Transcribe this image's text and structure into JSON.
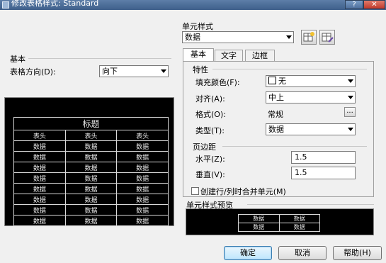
{
  "window": {
    "title": "修改表格样式: Standard",
    "help_glyph": "?",
    "close_glyph": "✕"
  },
  "left": {
    "basic_group_title": "基本",
    "direction_label": "表格方向(D):",
    "direction_value": "向下"
  },
  "preview": {
    "title": "标题",
    "header_cells": [
      "表头",
      "表头",
      "表头"
    ],
    "data_cell": "数据",
    "data_rows": 8
  },
  "cell_style": {
    "group_title": "单元样式",
    "value": "数据",
    "tabs": [
      "基本",
      "文字",
      "边框"
    ],
    "props_title": "特性",
    "fill_label": "填充颜色(F):",
    "fill_value": "无",
    "align_label": "对齐(A):",
    "align_value": "中上",
    "format_label": "格式(O):",
    "format_value": "常规",
    "format_button": "...",
    "type_label": "类型(T):",
    "type_value": "数据",
    "margins_title": "页边距",
    "horizontal_label": "水平(Z):",
    "horizontal_value": "1.5",
    "vertical_label": "垂直(V):",
    "vertical_value": "1.5",
    "merge_label": "创建行/列时合并单元(M)",
    "merge_checked": false,
    "style_preview_title": "单元样式预览",
    "style_preview_cells": [
      "数据",
      "数据",
      "数据",
      "数据"
    ]
  },
  "footer": {
    "ok": "确定",
    "cancel": "取消",
    "help": "帮助(H)"
  }
}
